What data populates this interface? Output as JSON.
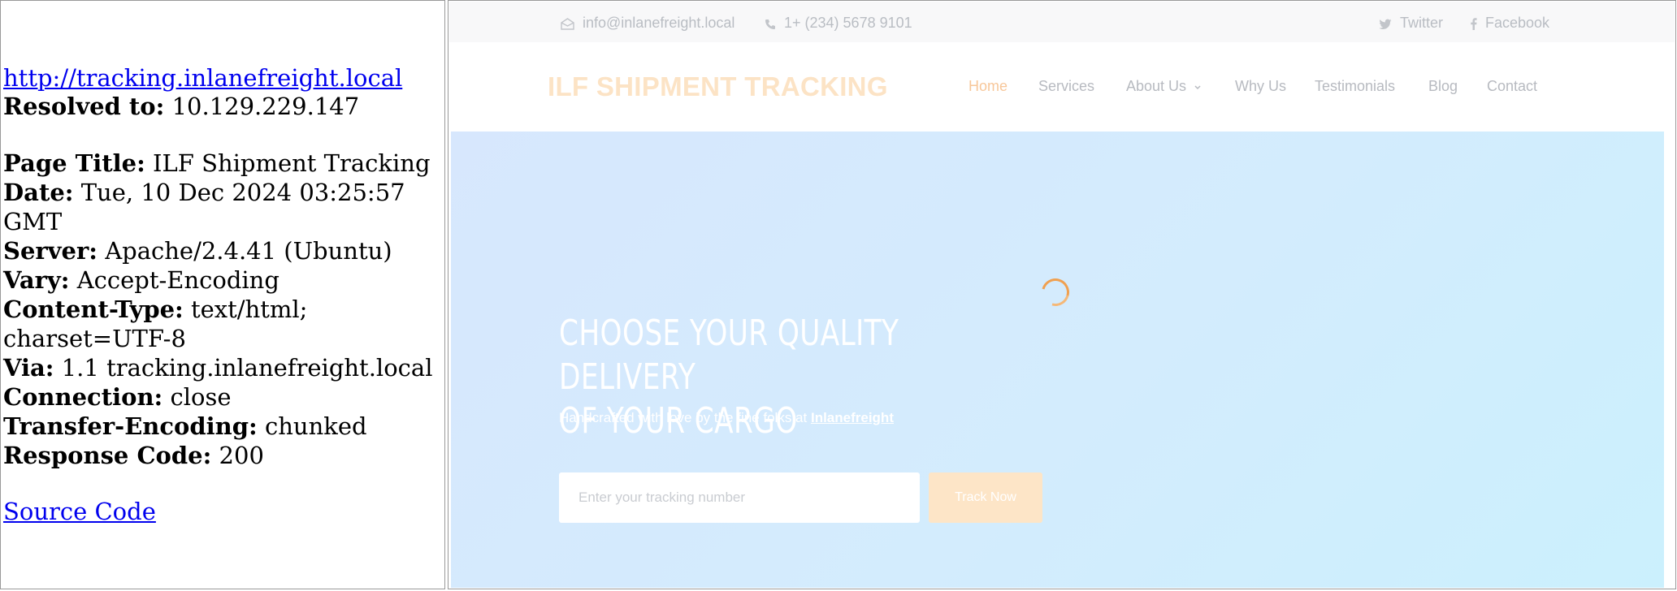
{
  "info": {
    "url": "http://tracking.inlanefreight.local",
    "headers": [
      {
        "key": "Resolved to:",
        "value": "10.129.229.147"
      },
      {
        "key": "Page Title:",
        "value": "ILF Shipment Tracking"
      },
      {
        "key": "Date:",
        "value": "Tue, 10 Dec 2024 03:25:57 GMT"
      },
      {
        "key": "Server:",
        "value": "Apache/2.4.41 (Ubuntu)"
      },
      {
        "key": "Vary:",
        "value": "Accept-Encoding"
      },
      {
        "key": "Content-Type:",
        "value": "text/html; charset=UTF-8"
      },
      {
        "key": "Via:",
        "value": "1.1 tracking.inlanefreight.local"
      },
      {
        "key": "Connection:",
        "value": "close"
      },
      {
        "key": "Transfer-Encoding:",
        "value": "chunked"
      },
      {
        "key": "Response Code:",
        "value": "200"
      }
    ],
    "source_link": "Source Code"
  },
  "site": {
    "topbar": {
      "email": "info@inlanefreight.local",
      "phone": "1+ (234) 5678 9101",
      "twitter": "Twitter",
      "facebook": "Facebook"
    },
    "brand": "ILF SHIPMENT TRACKING",
    "nav": [
      "Home",
      "Services",
      "About Us",
      "Why Us",
      "Testimonials",
      "Blog",
      "Contact"
    ],
    "hero": {
      "title_line1": "CHOOSE YOUR QUALITY DELIVERY",
      "title_line2": "OF YOUR CARGO",
      "subtitle": "Handcrafted with love by the fine folks at",
      "subtitle_link": "Inlanefreight",
      "input_placeholder": "Enter your tracking number",
      "button_label": "Track Now"
    }
  },
  "colors": {
    "accent": "#f0a050",
    "brand_faded": "#fce3c5",
    "hero_bg": "#d3ecfd"
  }
}
